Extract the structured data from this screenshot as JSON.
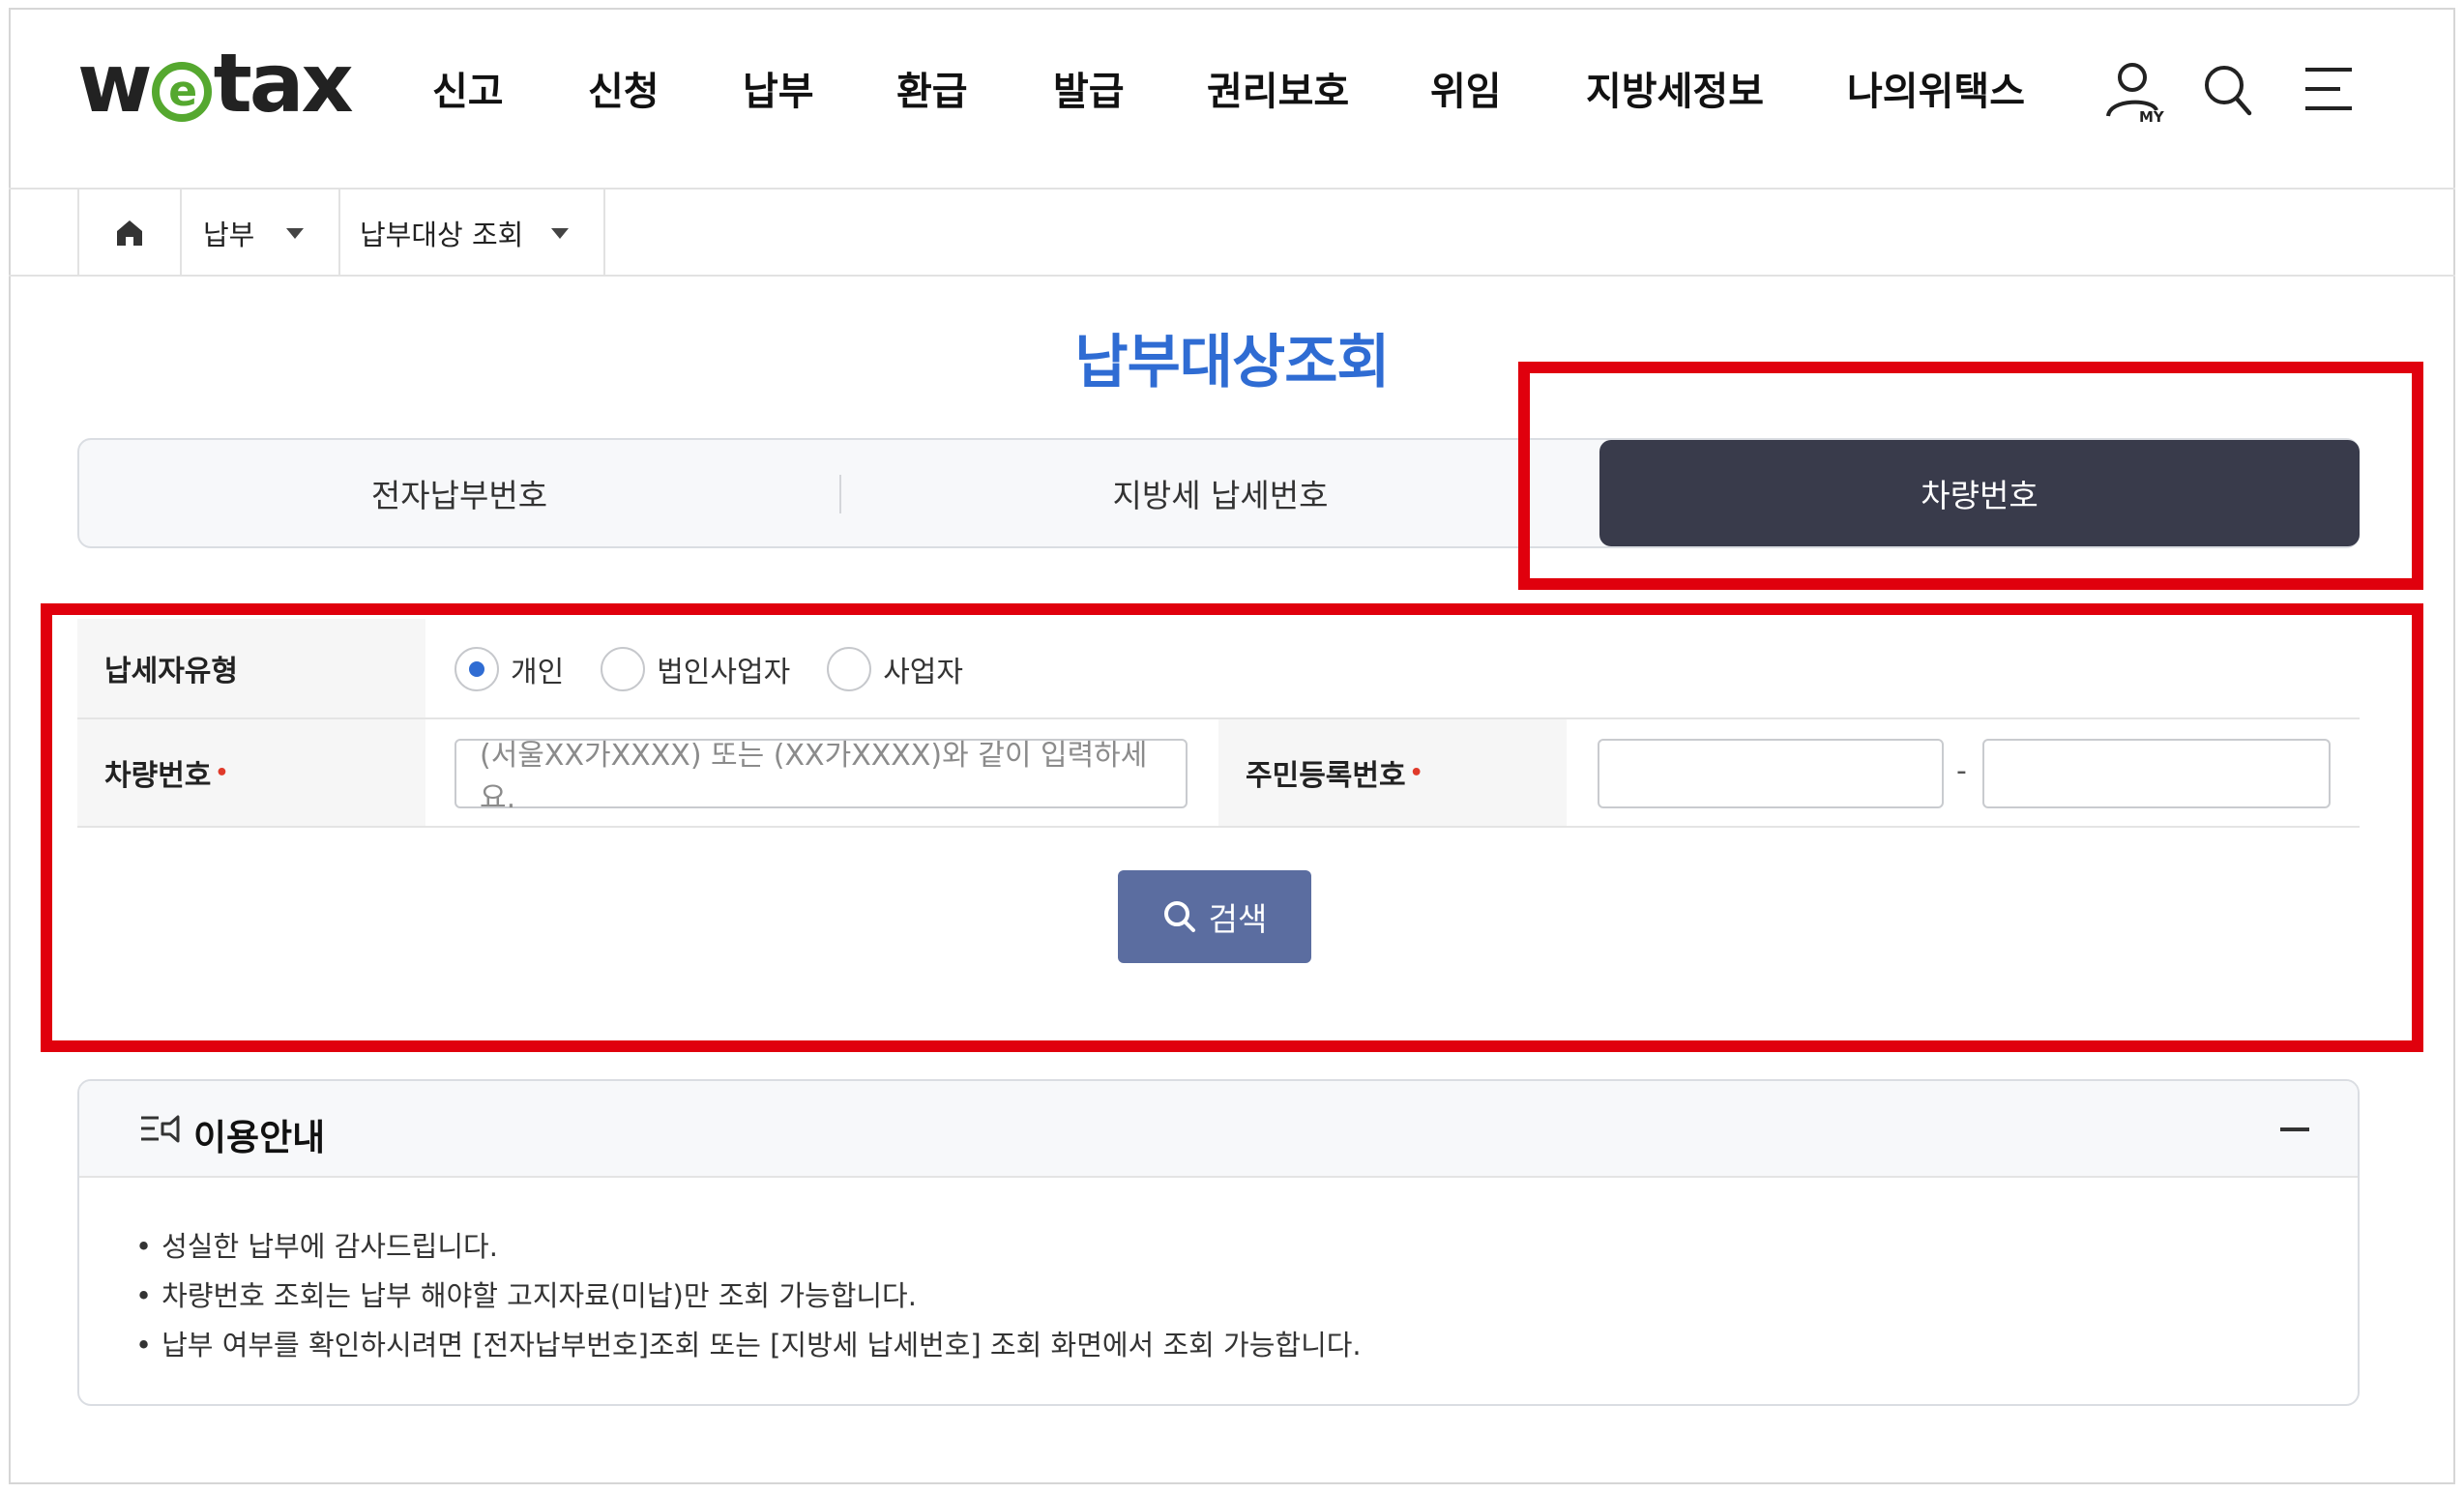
{
  "header": {
    "logo": {
      "w": "w",
      "e": "e",
      "rest": "tax"
    },
    "nav": [
      "신고",
      "신청",
      "납부",
      "환급",
      "발급",
      "권리보호",
      "위임",
      "지방세정보",
      "나의위택스"
    ],
    "my_label": "MY"
  },
  "breadcrumb": {
    "level1": "납부",
    "level2": "납부대상 조회"
  },
  "page": {
    "title": "납부대상조회"
  },
  "tabs": {
    "items": [
      "전자납부번호",
      "지방세 납세번호",
      "차량번호"
    ],
    "active": "차량번호"
  },
  "form": {
    "taxpayer_type_label": "납세자유형",
    "taxpayer_types": [
      "개인",
      "법인사업자",
      "사업자"
    ],
    "taxpayer_type_selected": "개인",
    "vehicle_label": "차량번호",
    "vehicle_placeholder": "(서울XX가XXXX) 또는 (XX가XXXX)와 같이 입력하세요.",
    "rrn_label": "주민등록번호",
    "rrn_separator": "-",
    "rrn_front": "",
    "rrn_back": "",
    "required_mark": "•",
    "search_label": "검색"
  },
  "guide": {
    "title": "이용안내",
    "items": [
      "성실한 납부에 감사드립니다.",
      "차량번호 조회는 납부 해야할 고지자료(미납)만 조회 가능합니다.",
      "납부 여부를 확인하시려면 [전자납부번호]조회 또는 [지방세 납세번호] 조회 화면에서 조회 가능합니다."
    ]
  },
  "colors": {
    "title_blue": "#2f6cd3",
    "tab_active_bg": "#393b4b",
    "search_button": "#5b6da0",
    "highlight_red": "#e0000d",
    "logo_green": "#55a82f"
  }
}
